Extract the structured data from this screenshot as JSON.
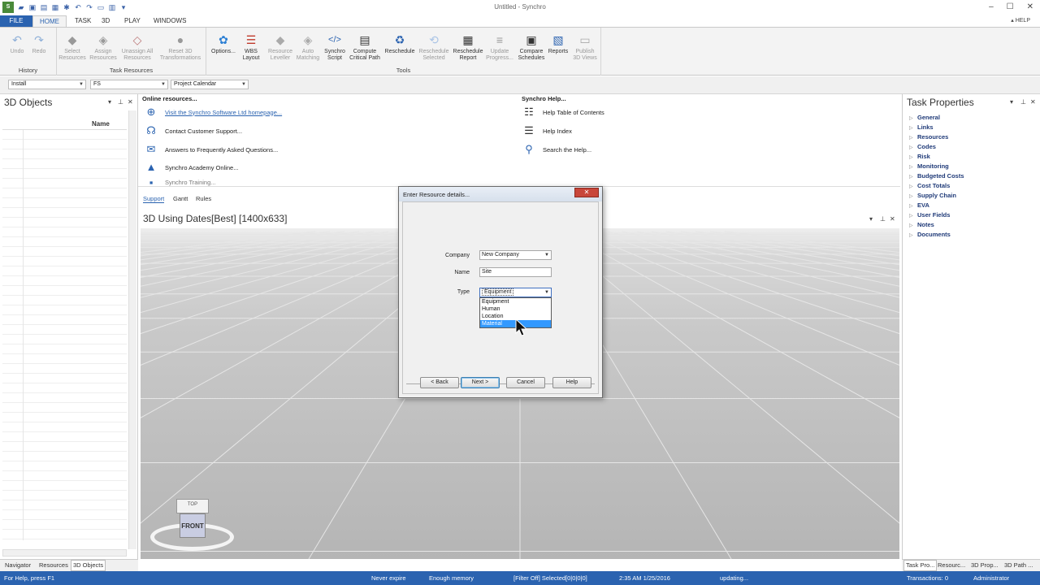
{
  "window": {
    "title": "Untitled - Synchro"
  },
  "ribbon_tabs": [
    "FILE",
    "HOME",
    "TASK",
    "3D",
    "PLAY",
    "WINDOWS"
  ],
  "help_label": "HELP",
  "ribbon": {
    "history": {
      "label": "History",
      "undo": "Undo",
      "redo": "Redo"
    },
    "task_resources": {
      "label": "Task Resources",
      "select": "Select\nResources",
      "assign": "Assign\nResources",
      "unassign": "Unassign All\nResources",
      "reset3d": "Reset 3D\nTransformations"
    },
    "tools": {
      "label": "Tools",
      "options": "Options...",
      "wbs": "WBS\nLayout",
      "leveller": "Resource\nLeveller",
      "auto": "Auto\nMatching",
      "script": "Synchro\nScript",
      "critical": "Compute\nCritical Path",
      "reschedule": "Reschedule",
      "resched_sel": "Reschedule\nSelected",
      "resched_rep": "Reschedule\nReport",
      "update": "Update\nProgress...",
      "compare": "Compare\nSchedules",
      "reports": "Reports",
      "publish": "Publish\n3D Views"
    }
  },
  "combos": {
    "first": "Install",
    "second": "FS",
    "third": "Project Calendar"
  },
  "left_panel": {
    "title": "3D Objects",
    "column": "Name",
    "tabs": [
      "Navigator",
      "Resources",
      "3D Objects"
    ]
  },
  "start_page": {
    "online_title": "Online resources...",
    "online": [
      "Visit the Synchro Software Ltd homepage...",
      "Contact Customer Support...",
      "Answers to Frequently Asked Questions...",
      "Synchro Academy Online...",
      "Synchro Training..."
    ],
    "help_title": "Synchro Help...",
    "help": [
      "Help Table of Contents",
      "Help Index",
      "Search the Help..."
    ],
    "tabs": [
      "Support",
      "Gantt",
      "Rules"
    ]
  },
  "view": {
    "title": "3D Using Dates[Best] [1400x633]",
    "cube_top": "TOP",
    "cube_front": "FRONT"
  },
  "right_panel": {
    "title": "Task Properties",
    "items": [
      "General",
      "Links",
      "Resources",
      "Codes",
      "Risk",
      "Monitoring",
      "Budgeted Costs",
      "Cost Totals",
      "Supply Chain",
      "EVA",
      "User Fields",
      "Notes",
      "Documents"
    ],
    "tabs": [
      "Task Pro...",
      "Resourc...",
      "3D Prop...",
      "3D Path ..."
    ]
  },
  "status": {
    "help": "For Help, press F1",
    "expire": "Never expire",
    "memory": "Enough memory",
    "filter": "[Filter Off]  Selected[0|0|0|0]",
    "datetime": "2:35 AM 1/25/2016",
    "updating": "updating...",
    "transactions": "Transactions: 0",
    "user": "Administrator"
  },
  "dialog": {
    "title": "Enter Resource details...",
    "company_label": "Company",
    "company_value": "New Company",
    "name_label": "Name",
    "name_value": "Site",
    "type_label": "Type",
    "type_value": "Equipment",
    "type_options": [
      "Equipment",
      "Human",
      "Location",
      "Material"
    ],
    "back": "< Back",
    "next": "Next >",
    "cancel": "Cancel",
    "help": "Help"
  },
  "colors": {
    "accent": "#2b63b0",
    "selection": "#3399ff",
    "close": "#c8463a"
  }
}
